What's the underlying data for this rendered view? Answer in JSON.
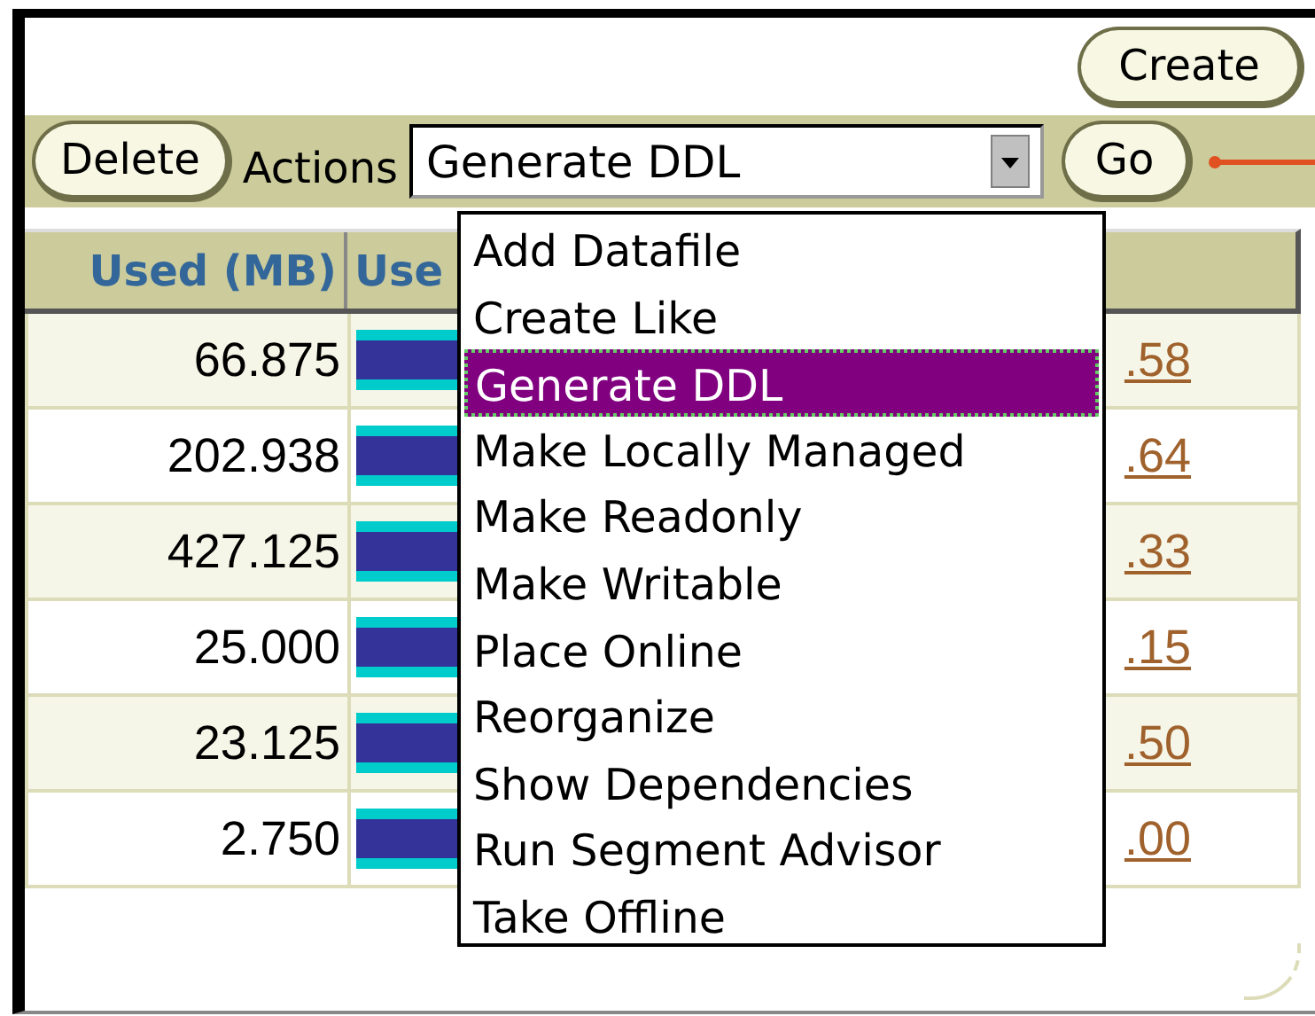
{
  "create_button": "Create",
  "toolbar": {
    "delete_button": "Delete",
    "actions_label": "Actions",
    "actions_value": "Generate DDL",
    "go_button": "Go"
  },
  "actions_menu": [
    {
      "label": "Add Datafile",
      "selected": false
    },
    {
      "label": "Create Like",
      "selected": false
    },
    {
      "label": "Generate DDL",
      "selected": true
    },
    {
      "label": "Make Locally Managed",
      "selected": false
    },
    {
      "label": "Make Readonly",
      "selected": false
    },
    {
      "label": "Make Writable",
      "selected": false
    },
    {
      "label": "Place Online",
      "selected": false
    },
    {
      "label": "Reorganize",
      "selected": false
    },
    {
      "label": "Show Dependencies",
      "selected": false
    },
    {
      "label": "Run Segment Advisor",
      "selected": false
    },
    {
      "label": "Take Offline",
      "selected": false
    }
  ],
  "table": {
    "columns": [
      "Used (MB)",
      "Use"
    ],
    "rows": [
      {
        "used": "66.875",
        "column_3": ".58"
      },
      {
        "used": "202.938",
        "column_3": ".64"
      },
      {
        "used": "427.125",
        "column_3": ".33"
      },
      {
        "used": "25.000",
        "column_3": ".15"
      },
      {
        "used": "23.125",
        "column_3": ".50"
      },
      {
        "used": "2.750",
        "column_3": ".00"
      }
    ]
  }
}
